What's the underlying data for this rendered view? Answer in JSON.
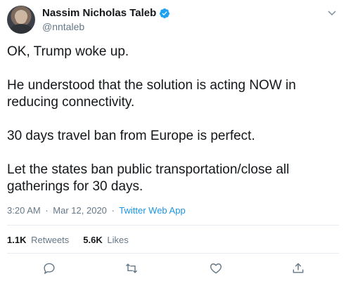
{
  "author": {
    "display_name": "Nassim Nicholas Taleb",
    "handle": "@nntaleb"
  },
  "tweet": {
    "paragraphs": [
      "OK, Trump woke up.",
      "He understood that the solution is acting NOW in reducing connectivity.",
      "30 days travel ban from Europe is perfect.",
      "Let the states ban public transportation/close all gatherings for 30 days."
    ]
  },
  "meta": {
    "time": "3:20 AM",
    "separator": "·",
    "date": "Mar 12, 2020",
    "source": "Twitter Web App"
  },
  "stats": {
    "retweets_count": "1.1K",
    "retweets_label": "Retweets",
    "likes_count": "5.6K",
    "likes_label": "Likes"
  },
  "colors": {
    "accent": "#1b95e0",
    "text": "#14171a",
    "muted": "#657786",
    "divider": "#e6ecf0"
  },
  "icons": [
    "verified-badge-icon",
    "chevron-down-icon",
    "reply-icon",
    "retweet-icon",
    "like-icon",
    "share-icon"
  ]
}
